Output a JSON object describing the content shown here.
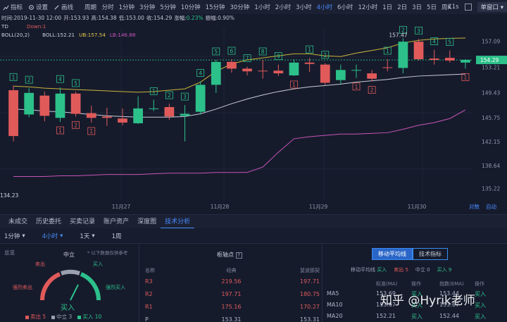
{
  "toolbar": {
    "indicators_label": "指标",
    "settings_label": "设置",
    "draw_label": "画线",
    "period_label": "周期",
    "timeframes": [
      "分时",
      "1分钟",
      "3分钟",
      "5分钟",
      "10分钟",
      "15分钟",
      "30分钟",
      "1小时",
      "2小时",
      "3小时",
      "4小时",
      "6小时",
      "12小时",
      "1日",
      "2日",
      "3日",
      "5日",
      "周K"
    ],
    "active_timeframe_index": 10,
    "interval_readout": "11s",
    "layout_label": "单窗口"
  },
  "ohlc": {
    "time": "时间:2019-11-30 12:00",
    "open": "开:153.93",
    "high": "高:154.38",
    "low": "低:153.00",
    "close": "收:154.29",
    "change_label": "涨幅:",
    "change_value": "0.23%",
    "amplitude": "振幅:0.90%"
  },
  "td_indicator": {
    "name": "TD",
    "down_label": "Down:1"
  },
  "boll_indicator": {
    "name": "BOLL(20,2)",
    "boll": "BOLL:152.21",
    "ub": "UB:157.54",
    "lb": "LB:146.88"
  },
  "price_axis": [
    "157.09",
    "154.29",
    "153.21",
    "149.43",
    "145.75",
    "142.15",
    "138.64",
    "135.22"
  ],
  "current_price": "154.29",
  "high_marker": "157.47",
  "low_marker": "134.23",
  "date_axis": [
    "11月27",
    "11月28",
    "11月29",
    "11月30"
  ],
  "zoom_label": "对数",
  "auto_label": "自动",
  "tabs": [
    "未成交",
    "历史委托",
    "买卖记录",
    "账户资产",
    "深度图",
    "技术分析"
  ],
  "active_tab_index": 5,
  "subbar": {
    "interval1": "1分钟",
    "interval2": "4小时",
    "interval3": "1天",
    "interval4": "1周"
  },
  "gauge": {
    "title": "总览",
    "neutral_label": "中立",
    "note": "* 以下数据仅供参考",
    "sell_label": "卖出",
    "buy_label": "买入",
    "strong_sell_label": "强烈卖出",
    "strong_buy_label": "强烈买入",
    "result": "买入",
    "legend_sell": "卖出 5",
    "legend_neutral": "中立 3",
    "legend_buy": "买入 10",
    "colors": {
      "sell": "#e05a5a",
      "neutral": "#9aa0ad",
      "buy": "#2cc08a"
    }
  },
  "pivot": {
    "title": "枢轴点",
    "headers": [
      "名称",
      "经典",
      "斐波那契"
    ],
    "rows": [
      {
        "name": "R3",
        "classic": "219.56",
        "fib": "197.71"
      },
      {
        "name": "R2",
        "classic": "197.71",
        "fib": "180.75"
      },
      {
        "name": "R1",
        "classic": "175.16",
        "fib": "170.27"
      },
      {
        "name": "P",
        "classic": "153.31",
        "fib": "153.31"
      }
    ]
  },
  "ma": {
    "tab_ma": "移动平均线",
    "tab_tech": "技术指标",
    "summary_label": "移动平均线",
    "summary_result": "买入",
    "summary_sell": "卖出 5",
    "summary_neutral": "中立 0",
    "summary_buy": "买入 9",
    "headers": [
      "",
      "标准(MA)",
      "操作",
      "指数(EMA)",
      "操作"
    ],
    "rows": [
      {
        "name": "MA5",
        "ma": "153.69",
        "op": "买入",
        "ema": "153.44",
        "op2": "买入"
      },
      {
        "name": "MA10",
        "ma": "153.67",
        "op": "买入",
        "ema": "153.67",
        "op2": "买入"
      },
      {
        "name": "MA20",
        "ma": "152.21",
        "op": "买入",
        "ema": "152.44",
        "op2": "买入"
      }
    ]
  },
  "watermark": "知乎 @Hyrik老师",
  "chart_data": {
    "type": "candlestick",
    "candles": [
      {
        "o": 149.8,
        "c": 143.0,
        "h": 150.5,
        "l": 142.2
      },
      {
        "o": 146.2,
        "c": 149.4,
        "h": 150.1,
        "l": 145.8
      },
      {
        "o": 149.0,
        "c": 146.0,
        "h": 149.6,
        "l": 145.2
      },
      {
        "o": 145.7,
        "c": 149.3,
        "h": 150.2,
        "l": 145.1
      },
      {
        "o": 149.3,
        "c": 146.3,
        "h": 149.6,
        "l": 145.9
      },
      {
        "o": 146.4,
        "c": 145.7,
        "h": 147.5,
        "l": 145.0
      },
      {
        "o": 145.9,
        "c": 145.7,
        "h": 147.2,
        "l": 144.5
      },
      {
        "o": 145.6,
        "c": 145.0,
        "h": 147.1,
        "l": 144.6
      },
      {
        "o": 144.9,
        "c": 147.1,
        "h": 148.9,
        "l": 144.8
      },
      {
        "o": 147.0,
        "c": 147.1,
        "h": 148.4,
        "l": 146.7
      },
      {
        "o": 147.3,
        "c": 145.9,
        "h": 147.8,
        "l": 145.4
      },
      {
        "o": 146.0,
        "c": 146.3,
        "h": 147.6,
        "l": 142.2
      },
      {
        "o": 146.6,
        "c": 150.6,
        "h": 151.1,
        "l": 146.2
      },
      {
        "o": 150.6,
        "c": 154.0,
        "h": 154.3,
        "l": 149.4
      },
      {
        "o": 154.0,
        "c": 153.0,
        "h": 154.4,
        "l": 152.4
      },
      {
        "o": 153.0,
        "c": 152.6,
        "h": 153.3,
        "l": 152.0
      },
      {
        "o": 152.7,
        "c": 152.6,
        "h": 154.3,
        "l": 151.5
      },
      {
        "o": 152.7,
        "c": 152.3,
        "h": 153.6,
        "l": 151.9
      },
      {
        "o": 152.0,
        "c": 153.9,
        "h": 154.4,
        "l": 151.9
      },
      {
        "o": 153.9,
        "c": 153.7,
        "h": 154.6,
        "l": 152.5
      },
      {
        "o": 153.6,
        "c": 150.9,
        "h": 153.8,
        "l": 150.6
      },
      {
        "o": 151.3,
        "c": 152.8,
        "h": 153.6,
        "l": 150.7
      },
      {
        "o": 152.7,
        "c": 152.8,
        "h": 153.6,
        "l": 151.6
      },
      {
        "o": 152.3,
        "c": 151.5,
        "h": 152.8,
        "l": 151.1
      },
      {
        "o": 153.2,
        "c": 153.1,
        "h": 154.4,
        "l": 152.6
      },
      {
        "o": 153.1,
        "c": 157.0,
        "h": 157.5,
        "l": 152.3
      },
      {
        "o": 157.0,
        "c": 154.4,
        "h": 157.4,
        "l": 154.2
      },
      {
        "o": 154.5,
        "c": 154.3,
        "h": 155.8,
        "l": 153.6
      },
      {
        "o": 154.6,
        "c": 154.2,
        "h": 155.7,
        "l": 153.9
      },
      {
        "o": 153.9,
        "c": 154.3,
        "h": 154.4,
        "l": 153.0
      }
    ],
    "ub": [
      150.4,
      150.3,
      150.1,
      150.0,
      149.9,
      149.8,
      149.7,
      149.6,
      149.5,
      149.6,
      149.8,
      150.0,
      151.0,
      152.6,
      153.7,
      154.3,
      154.6,
      154.9,
      155.2,
      155.2,
      154.9,
      154.8,
      155.3,
      155.7,
      156.1,
      156.8,
      157.2,
      157.4,
      157.5,
      157.54
    ],
    "mid": [
      147.0,
      146.9,
      146.7,
      146.6,
      146.4,
      146.2,
      146.0,
      145.9,
      145.8,
      145.8,
      145.8,
      145.9,
      146.3,
      147.0,
      147.8,
      148.5,
      149.1,
      149.6,
      150.0,
      150.3,
      150.5,
      150.7,
      151.0,
      151.2,
      151.4,
      151.7,
      151.9,
      152.0,
      152.1,
      152.21
    ],
    "lb": [
      137.0,
      137.0,
      137.0,
      137.1,
      137.1,
      137.2,
      137.3,
      137.3,
      137.3,
      137.4,
      137.5,
      137.5,
      137.5,
      137.6,
      137.6,
      137.6,
      138.4,
      140.6,
      142.6,
      142.9,
      143.1,
      143.3,
      143.3,
      143.4,
      143.5,
      144.0,
      144.6,
      145.0,
      145.6,
      146.88
    ],
    "td_labels_up": [
      {
        "i": 0,
        "n": "1"
      },
      {
        "i": 1,
        "n": "2"
      },
      {
        "i": 3,
        "n": "4"
      },
      {
        "i": 4,
        "n": "5"
      },
      {
        "i": 9,
        "n": "1"
      },
      {
        "i": 10,
        "n": "2"
      },
      {
        "i": 11,
        "n": "3"
      },
      {
        "i": 12,
        "n": "4"
      },
      {
        "i": 13,
        "n": "5"
      },
      {
        "i": 14,
        "n": "6"
      },
      {
        "i": 15,
        "n": "7"
      },
      {
        "i": 16,
        "n": "8"
      },
      {
        "i": 17,
        "n": "9"
      },
      {
        "i": 19,
        "n": "1"
      },
      {
        "i": 20,
        "n": "2"
      },
      {
        "i": 24,
        "n": "1"
      },
      {
        "i": 25,
        "n": "2"
      },
      {
        "i": 26,
        "n": "3"
      },
      {
        "i": 27,
        "n": "4"
      },
      {
        "i": 28,
        "n": "5"
      }
    ],
    "td_labels_down": [
      {
        "i": 3,
        "n": "1"
      },
      {
        "i": 4,
        "n": "2"
      },
      {
        "i": 5,
        "n": "1"
      },
      {
        "i": 18,
        "n": "1"
      },
      {
        "i": 22,
        "n": "1"
      },
      {
        "i": 23,
        "n": "2"
      },
      {
        "i": 29,
        "n": "1"
      }
    ],
    "ylim": [
      133.5,
      159.0
    ]
  }
}
